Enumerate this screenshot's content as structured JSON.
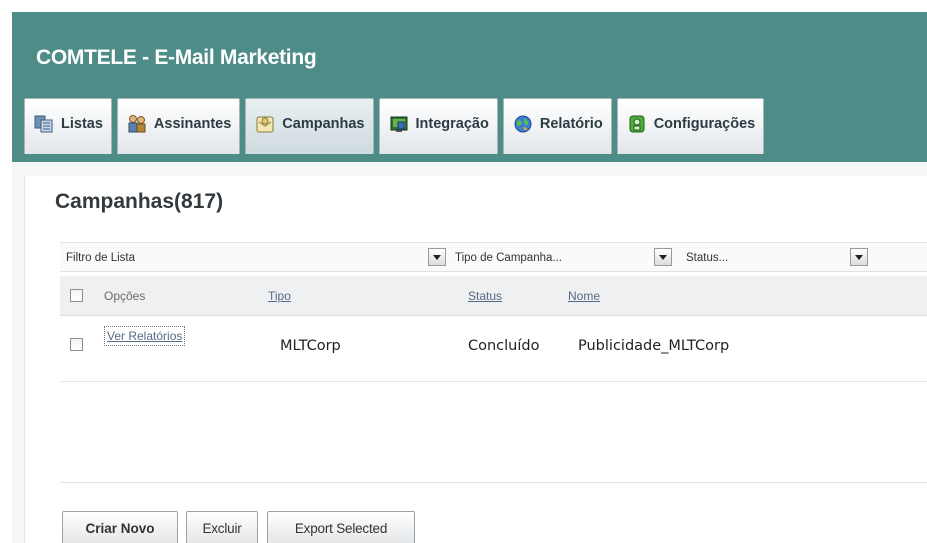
{
  "header": {
    "title": "COMTELE - E-Mail Marketing"
  },
  "tabs": [
    {
      "label": "Listas",
      "icon": "list-icon"
    },
    {
      "label": "Assinantes",
      "icon": "users-icon"
    },
    {
      "label": "Campanhas",
      "icon": "mail-icon",
      "active": true
    },
    {
      "label": "Integração",
      "icon": "integration-icon"
    },
    {
      "label": "Relatório",
      "icon": "globe-icon"
    },
    {
      "label": "Configurações",
      "icon": "config-icon"
    }
  ],
  "page": {
    "title": "Campanhas(817)"
  },
  "filters": {
    "list": "Filtro de Lista",
    "type": "Tipo de Campanha...",
    "status": "Status..."
  },
  "table": {
    "headers": {
      "options": "Opções",
      "type": "Tipo",
      "status": "Status",
      "name": "Nome"
    },
    "rows": [
      {
        "options": "Ver Relatórios",
        "type": "MLTCorp",
        "status": "Concluído",
        "name": "Publicidade_MLTCorp"
      }
    ]
  },
  "buttons": {
    "create": "Criar Novo",
    "delete": "Excluir",
    "export": "Export Selected"
  },
  "colors": {
    "header": "#4e8c88",
    "link": "#576a88"
  }
}
